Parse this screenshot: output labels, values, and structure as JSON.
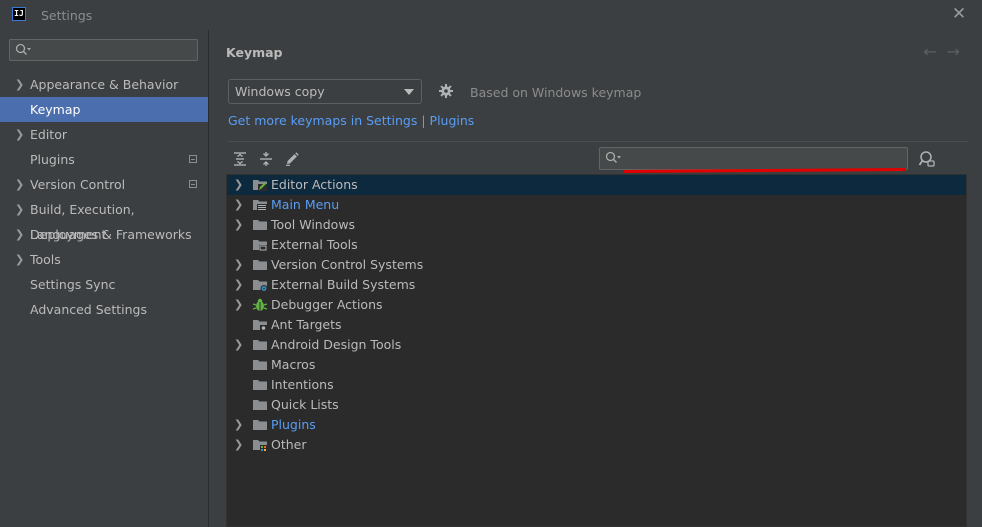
{
  "window": {
    "title": "Settings",
    "logo_text": "IJ"
  },
  "sidebar": {
    "items": [
      {
        "label": "Appearance & Behavior",
        "expandable": true,
        "selected": false,
        "badge": false
      },
      {
        "label": "Keymap",
        "expandable": false,
        "selected": true,
        "badge": false
      },
      {
        "label": "Editor",
        "expandable": true,
        "selected": false,
        "badge": false
      },
      {
        "label": "Plugins",
        "expandable": false,
        "selected": false,
        "badge": true
      },
      {
        "label": "Version Control",
        "expandable": true,
        "selected": false,
        "badge": true
      },
      {
        "label": "Build, Execution, Deployment",
        "expandable": true,
        "selected": false,
        "badge": false
      },
      {
        "label": "Languages & Frameworks",
        "expandable": true,
        "selected": false,
        "badge": false
      },
      {
        "label": "Tools",
        "expandable": true,
        "selected": false,
        "badge": false
      },
      {
        "label": "Settings Sync",
        "expandable": false,
        "selected": false,
        "badge": false
      },
      {
        "label": "Advanced Settings",
        "expandable": false,
        "selected": false,
        "badge": false
      }
    ]
  },
  "main": {
    "title": "Keymap",
    "keymap_select_value": "Windows copy",
    "based_on": "Based on Windows keymap",
    "more_keymaps_link": "Get more keymaps in Settings | Plugins"
  },
  "tree": {
    "rows": [
      {
        "label": "Editor Actions",
        "expandable": true,
        "selected": true,
        "link": false,
        "icon": "editor-actions-icon"
      },
      {
        "label": "Main Menu",
        "expandable": true,
        "selected": false,
        "link": true,
        "icon": "main-menu-icon"
      },
      {
        "label": "Tool Windows",
        "expandable": true,
        "selected": false,
        "link": false,
        "icon": "folder-icon"
      },
      {
        "label": "External Tools",
        "expandable": false,
        "selected": false,
        "link": false,
        "icon": "external-tools-icon"
      },
      {
        "label": "Version Control Systems",
        "expandable": true,
        "selected": false,
        "link": false,
        "icon": "folder-icon"
      },
      {
        "label": "External Build Systems",
        "expandable": true,
        "selected": false,
        "link": false,
        "icon": "build-systems-icon"
      },
      {
        "label": "Debugger Actions",
        "expandable": true,
        "selected": false,
        "link": false,
        "icon": "bug-icon"
      },
      {
        "label": "Ant Targets",
        "expandable": false,
        "selected": false,
        "link": false,
        "icon": "ant-targets-icon"
      },
      {
        "label": "Android Design Tools",
        "expandable": true,
        "selected": false,
        "link": false,
        "icon": "folder-icon"
      },
      {
        "label": "Macros",
        "expandable": false,
        "selected": false,
        "link": false,
        "icon": "folder-icon"
      },
      {
        "label": "Intentions",
        "expandable": false,
        "selected": false,
        "link": false,
        "icon": "folder-icon"
      },
      {
        "label": "Quick Lists",
        "expandable": false,
        "selected": false,
        "link": false,
        "icon": "folder-icon"
      },
      {
        "label": "Plugins",
        "expandable": true,
        "selected": false,
        "link": true,
        "icon": "folder-icon"
      },
      {
        "label": "Other",
        "expandable": true,
        "selected": false,
        "link": false,
        "icon": "other-icon"
      }
    ]
  },
  "colors": {
    "selection_sidebar": "#4b6eaf",
    "selection_tree": "#0d293e",
    "link": "#589df6",
    "annotation_underline": "#e00000"
  }
}
